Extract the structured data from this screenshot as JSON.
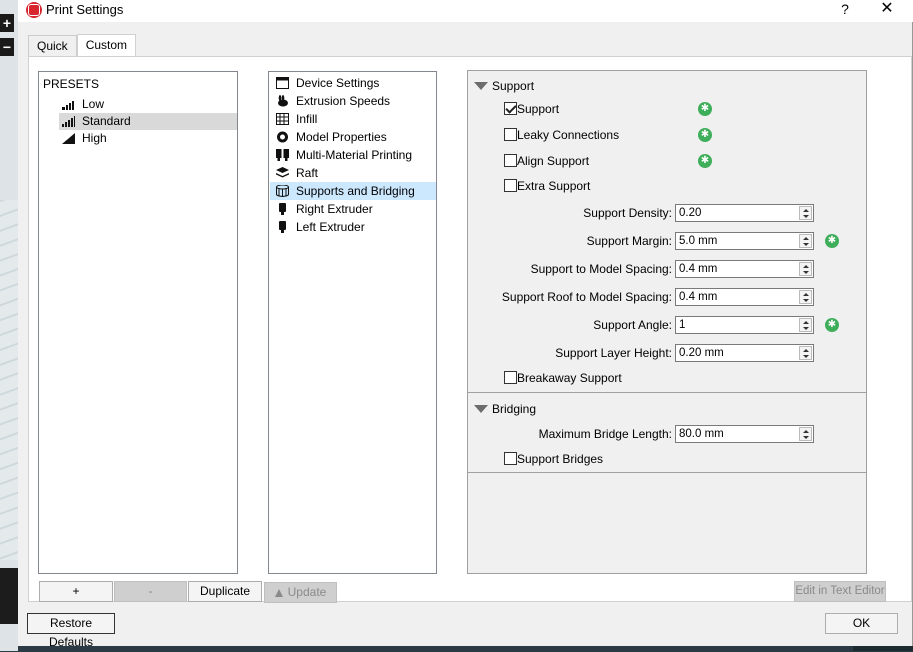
{
  "window": {
    "title": "Print Settings",
    "help": "?",
    "close": "✕"
  },
  "tabs": [
    {
      "label": "Quick"
    },
    {
      "label": "Custom"
    }
  ],
  "presets": {
    "header": "PRESETS",
    "items": [
      {
        "label": "Low"
      },
      {
        "label": "Standard"
      },
      {
        "label": "High"
      }
    ],
    "selected": "Standard"
  },
  "categories": {
    "items": [
      {
        "label": "Device Settings",
        "icon": "window-icon"
      },
      {
        "label": "Extrusion Speeds",
        "icon": "rabbit-icon"
      },
      {
        "label": "Infill",
        "icon": "infill-grid-icon"
      },
      {
        "label": "Model Properties",
        "icon": "model-ring-icon"
      },
      {
        "label": "Multi-Material Printing",
        "icon": "dual-extruder-icon"
      },
      {
        "label": "Raft",
        "icon": "layers-icon"
      },
      {
        "label": "Supports and Bridging",
        "icon": "support-cylinder-icon"
      },
      {
        "label": "Right Extruder",
        "icon": "extruder-icon"
      },
      {
        "label": "Left Extruder",
        "icon": "extruder-icon"
      }
    ],
    "selected": "Supports and Bridging"
  },
  "support": {
    "header": "Support",
    "checks": [
      {
        "label": "Support",
        "checked": true,
        "modified": true
      },
      {
        "label": "Leaky Connections",
        "checked": false,
        "modified": true
      },
      {
        "label": "Align Support",
        "checked": false,
        "modified": true
      },
      {
        "label": "Extra Support",
        "checked": false,
        "modified": false
      }
    ],
    "fields": [
      {
        "label": "Support Density:",
        "value": "0.20",
        "modified": false
      },
      {
        "label": "Support Margin:",
        "value": "5.0 mm",
        "modified": true
      },
      {
        "label": "Support to Model Spacing:",
        "value": "0.4 mm",
        "modified": false
      },
      {
        "label": "Support Roof to Model Spacing:",
        "value": "0.4 mm",
        "modified": false
      },
      {
        "label": "Support Angle:",
        "value": "1",
        "modified": true
      },
      {
        "label": "Support Layer Height:",
        "value": "0.20 mm",
        "modified": false
      }
    ],
    "breakaway": {
      "label": "Breakaway Support",
      "checked": false
    }
  },
  "bridging": {
    "header": "Bridging",
    "field": {
      "label": "Maximum Bridge Length:",
      "value": "80.0 mm"
    },
    "check": {
      "label": "Support Bridges",
      "checked": false
    }
  },
  "buttons": {
    "add": "+",
    "remove": "-",
    "duplicate": "Duplicate",
    "update": "Update",
    "edit_text": "Edit in Text Editor",
    "restore": "Restore Defaults",
    "ok": "OK"
  },
  "colors": {
    "modified_indicator": "#3fae5b",
    "selection": "#cce8ff",
    "preset_selection": "#d9d9d9"
  }
}
